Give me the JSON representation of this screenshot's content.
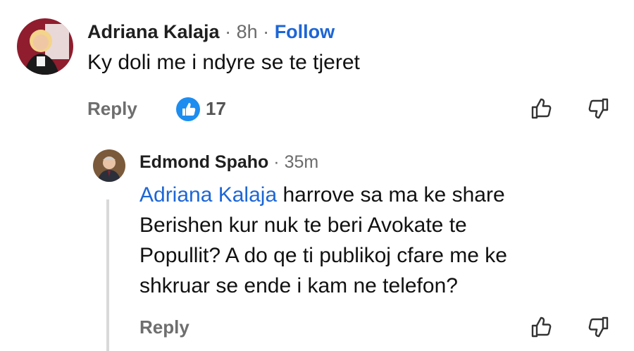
{
  "comment": {
    "author": "Adriana Kalaja",
    "time": "8h",
    "sep1": "·",
    "sep2": "·",
    "follow_label": "Follow",
    "text": "Ky doli me i ndyre se te tjeret",
    "reply_label": "Reply",
    "like_count": "17"
  },
  "reply": {
    "author": "Edmond Spaho",
    "sep": "·",
    "time": "35m",
    "mention": "Adriana Kalaja",
    "line1_rest": " harrove sa ma ke share",
    "line2": "Berishen kur nuk te beri Avokate te",
    "line3": "Popullit? A do qe ti publikoj cfare me ke",
    "line4": "shkruar se ende i kam ne telefon?",
    "reply_label": "Reply"
  },
  "icons": {
    "like_badge": "thumbs-up-badge-icon",
    "thumbs_up": "thumbs-up-icon",
    "thumbs_down": "thumbs-down-icon"
  },
  "colors": {
    "link_blue": "#1d66d6",
    "muted_text": "#6e6e6e"
  }
}
